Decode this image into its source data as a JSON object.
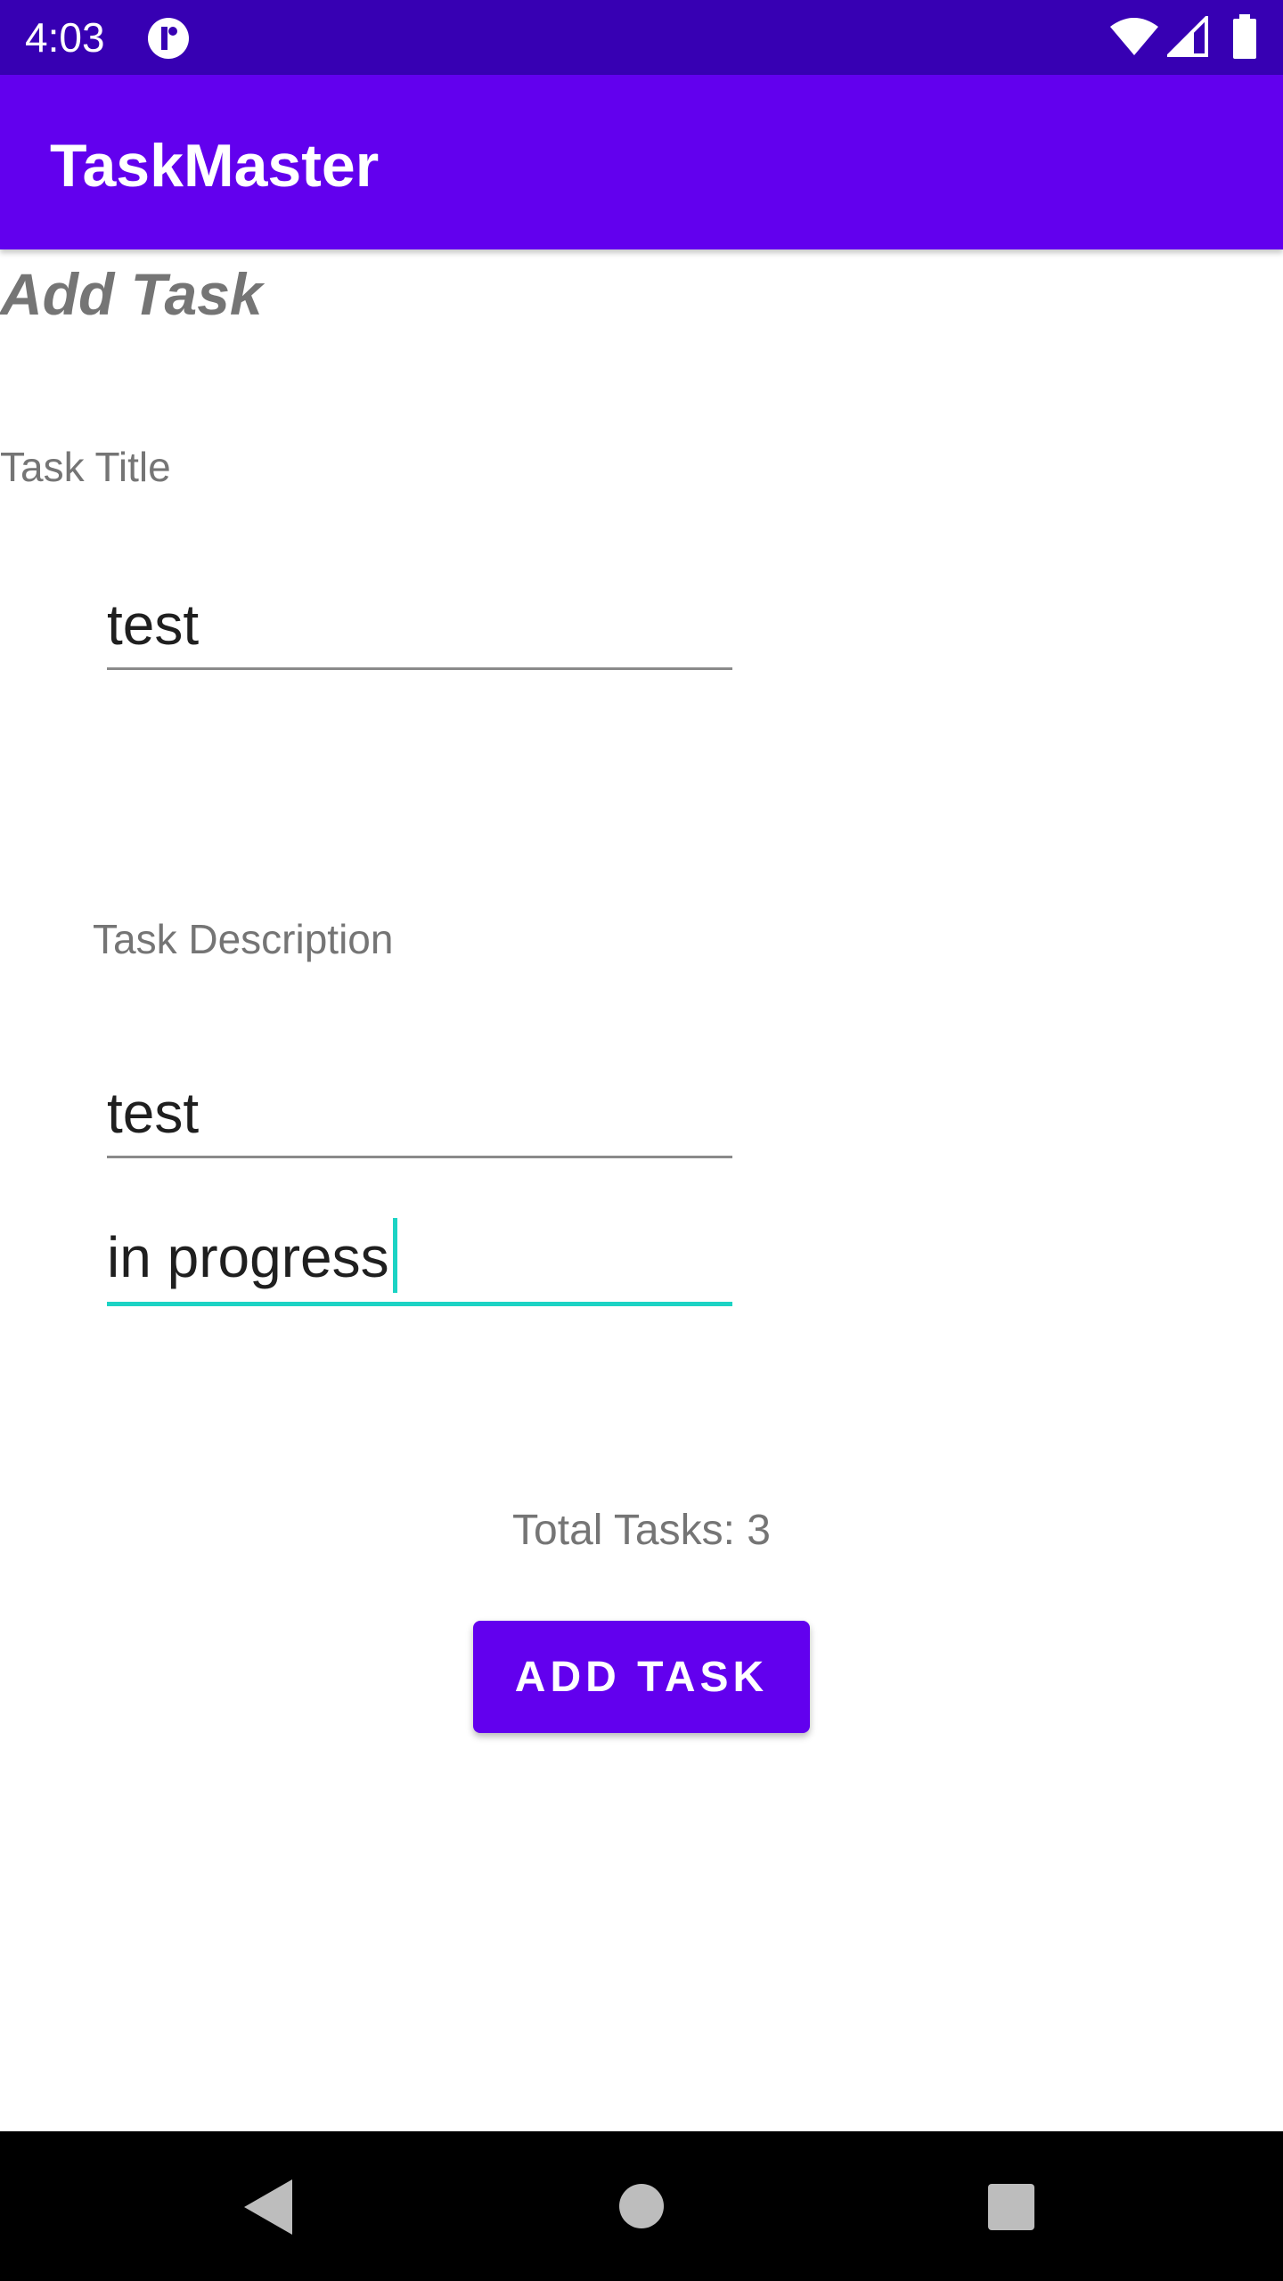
{
  "status_bar": {
    "time": "4:03",
    "icons": [
      "app-notification-icon",
      "wifi-icon",
      "cell-signal-icon",
      "battery-icon"
    ],
    "background": "#3700b3"
  },
  "app_bar": {
    "title": "TaskMaster",
    "background": "#6200ee"
  },
  "page": {
    "heading": "Add Task"
  },
  "form": {
    "title_label": "Task Title",
    "title_value": "test",
    "description_label": "Task Description",
    "description_value": "test",
    "status_value": "in progress",
    "focus_color": "#1cd3c4"
  },
  "summary": {
    "total_tasks": "Total Tasks: 3"
  },
  "actions": {
    "add_task_label": "ADD TASK",
    "accent": "#6200ee"
  },
  "nav_bar": {
    "icons": [
      "back-icon",
      "home-icon",
      "recents-icon"
    ]
  }
}
